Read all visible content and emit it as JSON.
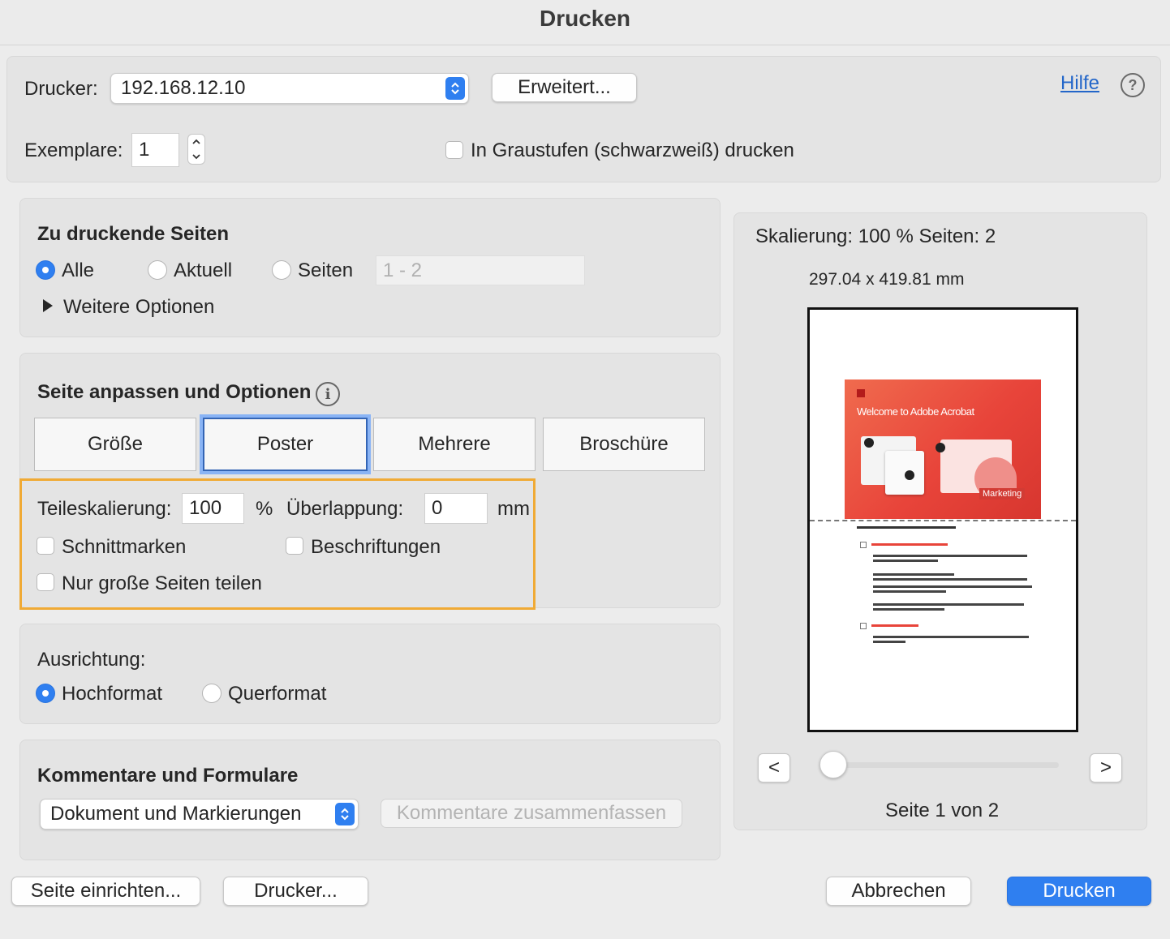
{
  "window": {
    "title": "Drucken"
  },
  "top": {
    "printer_label": "Drucker:",
    "printer_value": "192.168.12.10",
    "advanced_button": "Erweitert...",
    "help_link": "Hilfe",
    "help_icon": "?",
    "copies_label": "Exemplare:",
    "copies_value": "1",
    "grayscale_label": "In Graustufen (schwarzweiß) drucken"
  },
  "pages": {
    "heading": "Zu druckende Seiten",
    "option_all": "Alle",
    "option_current": "Aktuell",
    "option_pages": "Seiten",
    "pages_range": "1 - 2",
    "more_options": "Weitere Optionen",
    "selected": "Alle"
  },
  "sizing": {
    "heading": "Seite anpassen und Optionen",
    "info_icon": "i",
    "tabs": [
      "Größe",
      "Poster",
      "Mehrere",
      "Broschüre"
    ],
    "selected_tab": "Poster",
    "tile_scale_label": "Teileskalierung:",
    "tile_scale_value": "100",
    "tile_scale_unit": "%",
    "overlap_label": "Überlappung:",
    "overlap_value": "0",
    "overlap_unit": "mm",
    "cut_marks": "Schnittmarken",
    "labels": "Beschriftungen",
    "tile_large_only": "Nur große Seiten teilen",
    "highlight_color": "#f0aa35"
  },
  "orientation": {
    "label": "Ausrichtung:",
    "portrait": "Hochformat",
    "landscape": "Querformat",
    "selected": "Hochformat"
  },
  "comments": {
    "heading": "Kommentare und Formulare",
    "select_value": "Dokument und Markierungen",
    "summarize_button": "Kommentare zusammenfassen"
  },
  "preview": {
    "scaling_text": "Skalierung: 100 % Seiten: 2",
    "dimensions": "297.04 x 419.81 mm",
    "thumb_title": "Welcome to Adobe Acrobat",
    "thumb_tag": "Marketing",
    "prev": "<",
    "next": ">",
    "page_indicator": "Seite 1 von 2",
    "slider_position": 0
  },
  "footer": {
    "page_setup": "Seite einrichten...",
    "printer": "Drucker...",
    "cancel": "Abbrechen",
    "print": "Drucken"
  },
  "colors": {
    "accent": "#2f7ff0",
    "thumb_red": "#e8443a"
  }
}
